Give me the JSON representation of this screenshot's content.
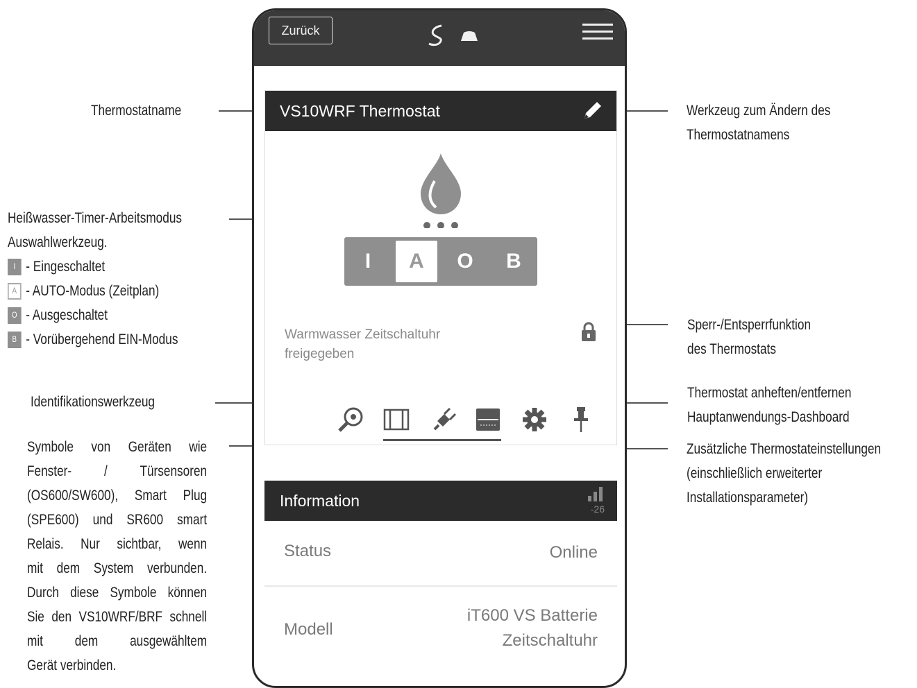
{
  "phone": {
    "back_label": "Zurück",
    "thermostat_name": "VS10WRF Thermostat",
    "modes": [
      "I",
      "A",
      "O",
      "B"
    ],
    "active_mode": "A",
    "status_text_line1": "Warmwasser Zeitschaltuhr",
    "status_text_line2": "freigegeben",
    "info": {
      "title": "Information",
      "signal_value": "-26",
      "rows": [
        {
          "key": "Status",
          "value": "Online"
        },
        {
          "key": "Modell",
          "value_line1": "iT600 VS Batterie",
          "value_line2": "Zeitschaltuhr"
        }
      ]
    }
  },
  "callouts": {
    "thermostat_name": "Thermostatname",
    "rename_tool_line1": "Werkzeug zum Ändern des",
    "rename_tool_line2": "Thermostatnamens",
    "mode_tool_line1": "Heißwasser-Timer-Arbeitsmodus",
    "mode_tool_line2": "Auswahlwerkzeug.",
    "legend": [
      {
        "box": "I",
        "text": "- Eingeschaltet"
      },
      {
        "box": "A",
        "text": "- AUTO-Modus (Zeitplan)"
      },
      {
        "box": "O",
        "text": "- Ausgeschaltet"
      },
      {
        "box": "B",
        "text": "- Vorübergehend EIN-Modus"
      }
    ],
    "lock_line1": "Sperr-/Entsperrfunktion",
    "lock_line2": "des Thermostats",
    "identify": "Identifikationswerkzeug",
    "pin_line1": "Thermostat anheften/entfernen",
    "pin_line2": "Hauptanwendungs-Dashboard",
    "settings_line1": "Zusätzliche Thermostateinstellungen",
    "settings_line2": "(einschließlich erweiterter",
    "settings_line3": "Installationsparameter)",
    "devices_lines": [
      "Symbole von Geräten wie",
      "Fenster- / Türsensoren",
      "(OS600/SW600), Smart Plug",
      "(SPE600) und SR600 smart",
      "Relais. Nur sichtbar, wenn",
      "mit dem System verbunden.",
      "Durch diese Symbole können",
      "Sie den VS10WRF/BRF schnell",
      "mit dem ausgewähltem",
      "Gerät verbinden."
    ]
  },
  "colors": {
    "topbar": "#3a3a3a",
    "card_header": "#2b2b2b",
    "mode_bar": "#8f8f8f"
  }
}
